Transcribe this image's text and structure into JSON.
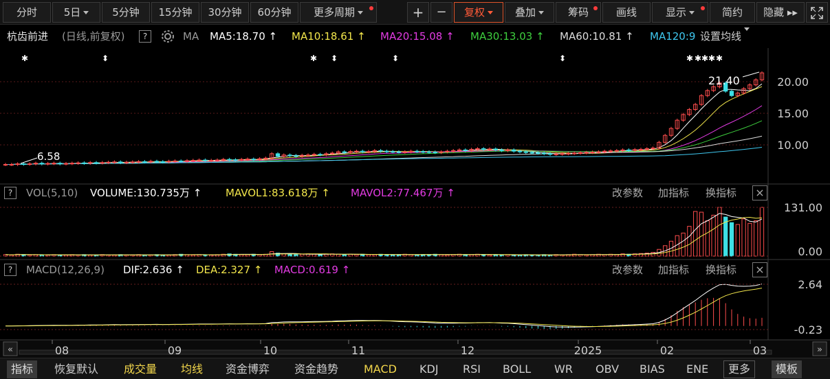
{
  "toolbar": {
    "periods": [
      "分时",
      "5日",
      "5分钟",
      "15分钟",
      "30分钟",
      "60分钟",
      "更多周期"
    ],
    "plus": "+",
    "minus": "−",
    "fuquan": "复权",
    "diejia": "叠加",
    "chouma": "筹码",
    "huaxian": "画线",
    "xianshi": "显示",
    "jianyue": "简约",
    "yincang": "隐藏 ▸▸",
    "fullscreen_icon": "expand-icon"
  },
  "main_info": {
    "stock_name": "杭齿前进",
    "mode": "(日线,前复权)",
    "q": "?",
    "ma_label": "MA",
    "ma5": "MA5:18.70",
    "ma10": "MA10:18.61",
    "ma20": "MA20:15.08",
    "ma30": "MA30:13.03",
    "ma60": "MA60:10.81",
    "ma120": "MA120:9",
    "set_ma": "设置均线",
    "arrow": "↑"
  },
  "price_labels": {
    "high": "21.40",
    "low": "6.58",
    "axis": [
      "20.00",
      "15.00",
      "10.00"
    ]
  },
  "vol_panel": {
    "q": "?",
    "title": "VOL(5,10)",
    "volume": "VOLUME:130.735万",
    "mavol1": "MAVOL1:83.618万",
    "mavol2": "MAVOL2:77.467万",
    "arrow": "↑",
    "btn_params": "改参数",
    "btn_add": "加指标",
    "btn_switch": "换指标",
    "close": "×",
    "axis": [
      "131.00",
      "0.00"
    ]
  },
  "macd_panel": {
    "q": "?",
    "title": "MACD(12,26,9)",
    "dif": "DIF:2.636",
    "dea": "DEA:2.327",
    "macd": "MACD:0.619",
    "arrow": "↑",
    "btn_params": "改参数",
    "btn_add": "加指标",
    "btn_switch": "换指标",
    "close": "×",
    "axis": [
      "2.64",
      "-0.23"
    ]
  },
  "date_axis": [
    "08",
    "09",
    "10",
    "11",
    "12",
    "2025",
    "02",
    "03"
  ],
  "bottombar": {
    "items": [
      "指标",
      "恢复默认",
      "成交量",
      "均线",
      "资金博弈",
      "资金趋势",
      "MACD",
      "KDJ",
      "RSI",
      "BOLL",
      "WR",
      "OBV",
      "BIAS",
      "ENE"
    ],
    "more": "更多",
    "template": "模板"
  },
  "colors": {
    "up": "#ff4d4d",
    "down": "#3ee0e6",
    "ma5": "#ffffff",
    "ma10": "#f2e64b",
    "ma20": "#e23be2",
    "ma30": "#3ecf3e",
    "ma60": "#dddddd",
    "ma120": "#3fc8f0"
  },
  "chart_data": {
    "type": "candlestick",
    "x_ticks": [
      "08",
      "09",
      "10",
      "11",
      "12",
      "2025",
      "02",
      "03"
    ],
    "y_ticks": [
      20.0,
      15.0,
      10.0
    ],
    "high_label": 21.4,
    "low_label": 6.58,
    "close_series": [
      6.9,
      6.9,
      7.0,
      6.95,
      7.0,
      7.1,
      7.0,
      7.05,
      7.1,
      7.0,
      7.05,
      7.1,
      7.15,
      7.1,
      7.2,
      7.15,
      7.2,
      7.25,
      7.3,
      7.2,
      7.25,
      7.3,
      7.35,
      7.3,
      7.4,
      7.35,
      7.3,
      7.4,
      7.45,
      7.4,
      7.5,
      7.55,
      7.6,
      7.5,
      7.55,
      7.6,
      7.7,
      7.65,
      7.6,
      7.7,
      7.75,
      7.7,
      7.8,
      7.9,
      8.6,
      8.2,
      8.4,
      8.3,
      8.2,
      8.35,
      8.4,
      8.5,
      8.45,
      8.6,
      8.7,
      8.9,
      8.8,
      8.95,
      9.0,
      8.9,
      8.95,
      9.1,
      9.0,
      8.95,
      8.9,
      8.85,
      8.9,
      9.0,
      8.95,
      8.9,
      8.85,
      8.8,
      8.9,
      9.0,
      9.1,
      9.2,
      9.1,
      9.3,
      9.4,
      9.3,
      9.35,
      9.2,
      9.1,
      9.2,
      9.0,
      8.9,
      8.8,
      8.75,
      8.7,
      8.6,
      8.5,
      8.55,
      8.6,
      8.65,
      8.7,
      8.75,
      8.8,
      8.85,
      8.9,
      9.0,
      9.05,
      9.1,
      9.2,
      9.15,
      9.25,
      9.3,
      9.4,
      9.5,
      10.4,
      11.5,
      12.6,
      13.9,
      14.8,
      15.6,
      16.4,
      17.8,
      18.6,
      19.2,
      19.8,
      18.5,
      17.8,
      18.2,
      18.9,
      19.5,
      20.3,
      21.4
    ],
    "volume_series": [
      4,
      3,
      5,
      4,
      3,
      4,
      3,
      3,
      4,
      3,
      3,
      4,
      3,
      4,
      3,
      3,
      4,
      3,
      3,
      4,
      3,
      3,
      4,
      3,
      3,
      4,
      3,
      3,
      4,
      5,
      4,
      3,
      4,
      3,
      3,
      4,
      5,
      6,
      5,
      4,
      4,
      5,
      4,
      5,
      12,
      8,
      6,
      5,
      4,
      5,
      6,
      5,
      4,
      5,
      6,
      5,
      4,
      5,
      4,
      5,
      4,
      4,
      5,
      4,
      3,
      4,
      5,
      4,
      3,
      4,
      4,
      5,
      4,
      3,
      4,
      5,
      4,
      4,
      5,
      4,
      3,
      4,
      3,
      4,
      3,
      3,
      4,
      3,
      3,
      4,
      3,
      4,
      3,
      4,
      5,
      4,
      3,
      4,
      5,
      4,
      5,
      4,
      6,
      5,
      6,
      7,
      8,
      10,
      18,
      28,
      40,
      55,
      62,
      80,
      120,
      118,
      95,
      110,
      131,
      105,
      90,
      85,
      100,
      88,
      95,
      131
    ],
    "macd": {
      "dif": 2.636,
      "dea": 2.327,
      "macd": 0.619,
      "ylim": [
        -0.23,
        2.64
      ]
    }
  }
}
